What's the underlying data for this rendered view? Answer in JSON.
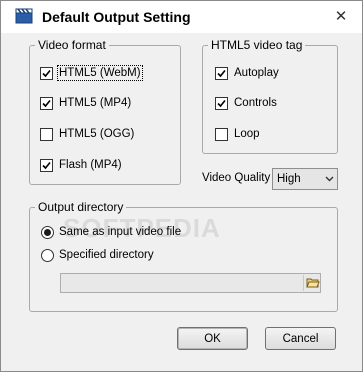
{
  "window": {
    "title": "Default Output Setting",
    "close_glyph": "✕"
  },
  "video_format": {
    "legend": "Video format",
    "options": [
      {
        "label": "HTML5 (WebM)",
        "checked": true
      },
      {
        "label": "HTML5 (MP4)",
        "checked": true
      },
      {
        "label": "HTML5 (OGG)",
        "checked": false
      },
      {
        "label": "Flash (MP4)",
        "checked": true
      }
    ]
  },
  "html5_tag": {
    "legend": "HTML5 video tag",
    "options": [
      {
        "label": "Autoplay",
        "checked": true
      },
      {
        "label": "Controls",
        "checked": true
      },
      {
        "label": "Loop",
        "checked": false
      }
    ]
  },
  "video_quality": {
    "label": "Video Quality",
    "selected": "High"
  },
  "output_directory": {
    "legend": "Output directory",
    "options": [
      {
        "label": "Same as input video file",
        "selected": true
      },
      {
        "label": "Specified directory",
        "selected": false
      }
    ],
    "path_value": ""
  },
  "buttons": {
    "ok": "OK",
    "cancel": "Cancel"
  },
  "watermark": "SOFTPEDIA",
  "icons": {
    "app": "video-clapper-icon",
    "close": "close-icon",
    "browse": "folder-open-icon",
    "dropdown": "chevron-down-icon"
  }
}
